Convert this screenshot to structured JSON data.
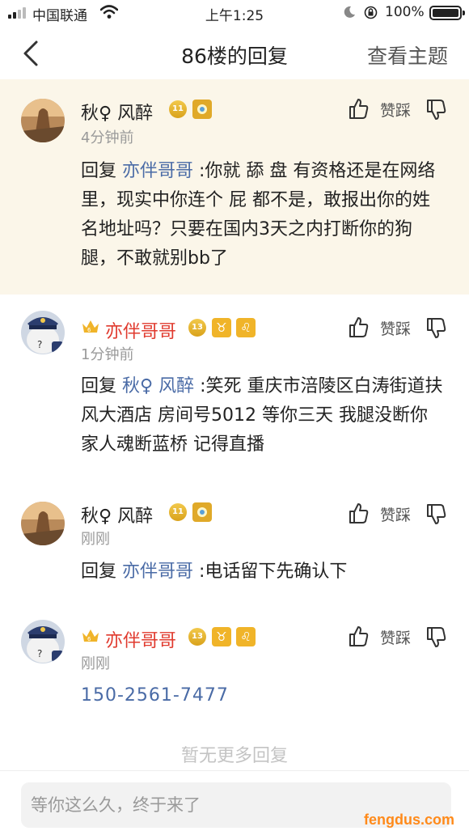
{
  "status_bar": {
    "carrier": "中国联通",
    "time": "上午1:25",
    "battery": "100%"
  },
  "nav": {
    "title": "86楼的回复",
    "view_topic": "查看主题"
  },
  "vote_label": "赞踩",
  "replies": [
    {
      "user": "秋♀ 风醉",
      "level": "11",
      "time": "4分钟前",
      "prefix": "回复 ",
      "mention": "亦伴哥哥",
      "text": " :你就 舔 盘 有资格还是在网络里，现实中你连个 屁 都不是，敢报出你的姓名地址吗？只要在国内3天之内打断你的狗腿，不敢就别bb了"
    },
    {
      "user": "亦伴哥哥",
      "level": "13",
      "time": "1分钟前",
      "prefix": "回复 ",
      "mention": "秋♀ 风醉",
      "text": " :笑死 重庆市涪陵区白涛街道扶风大酒店 房间号5012 等你三天 我腿没断你家人魂断蓝桥 记得直播"
    },
    {
      "user": "秋♀ 风醉",
      "level": "11",
      "time": "刚刚",
      "prefix": "回复 ",
      "mention": "亦伴哥哥",
      "text": " :电话留下先确认下"
    },
    {
      "user": "亦伴哥哥",
      "level": "13",
      "time": "刚刚",
      "phone": "150-2561-7477"
    }
  ],
  "footer": {
    "no_more": "暂无更多回复"
  },
  "input": {
    "placeholder": "等你这么久，终于来了"
  },
  "watermark": "fengdus.com",
  "colors": {
    "highlight_bg": "#fbf6e9",
    "mention": "#4a6ba6",
    "vip_name": "#e03a2e",
    "badge_gold": "#f0b429"
  }
}
